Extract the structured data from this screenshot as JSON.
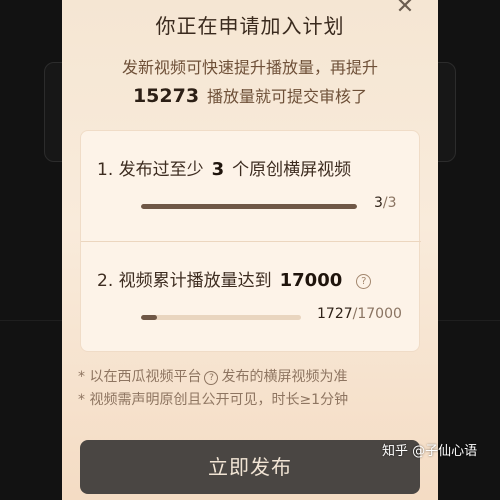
{
  "modal": {
    "close_symbol": "✕",
    "title": "你正在申请加入计划",
    "subtitle_line1": "发新视频可快速提升播放量，再提升",
    "subtitle_number": "15273",
    "subtitle_line2": "播放量就可提交审核了"
  },
  "tasks": [
    {
      "prefix": "1. 发布过至少",
      "highlight": "3",
      "suffix": "个原创横屏视频",
      "current": "3",
      "total": "/3",
      "progress": 1.0
    },
    {
      "prefix": "2. 视频累计播放量达到",
      "highlight": "17000",
      "suffix": "",
      "help": "?",
      "current": "1727",
      "total": "/17000",
      "progress": 0.1016
    }
  ],
  "notes": {
    "line1_prefix": "* 以在西瓜视频平台",
    "line1_icon": "?",
    "line1_suffix": "发布的横屏视频为准",
    "line2": "* 视频需声明原创且公开可见，时长≥1分钟"
  },
  "publish_button": "立即发布",
  "watermark": "知乎 @子仙心语",
  "colors": {
    "modal_bg": "#f7e8d6",
    "button_bg": "#4a4643",
    "bar_fill": "#6f5746"
  }
}
